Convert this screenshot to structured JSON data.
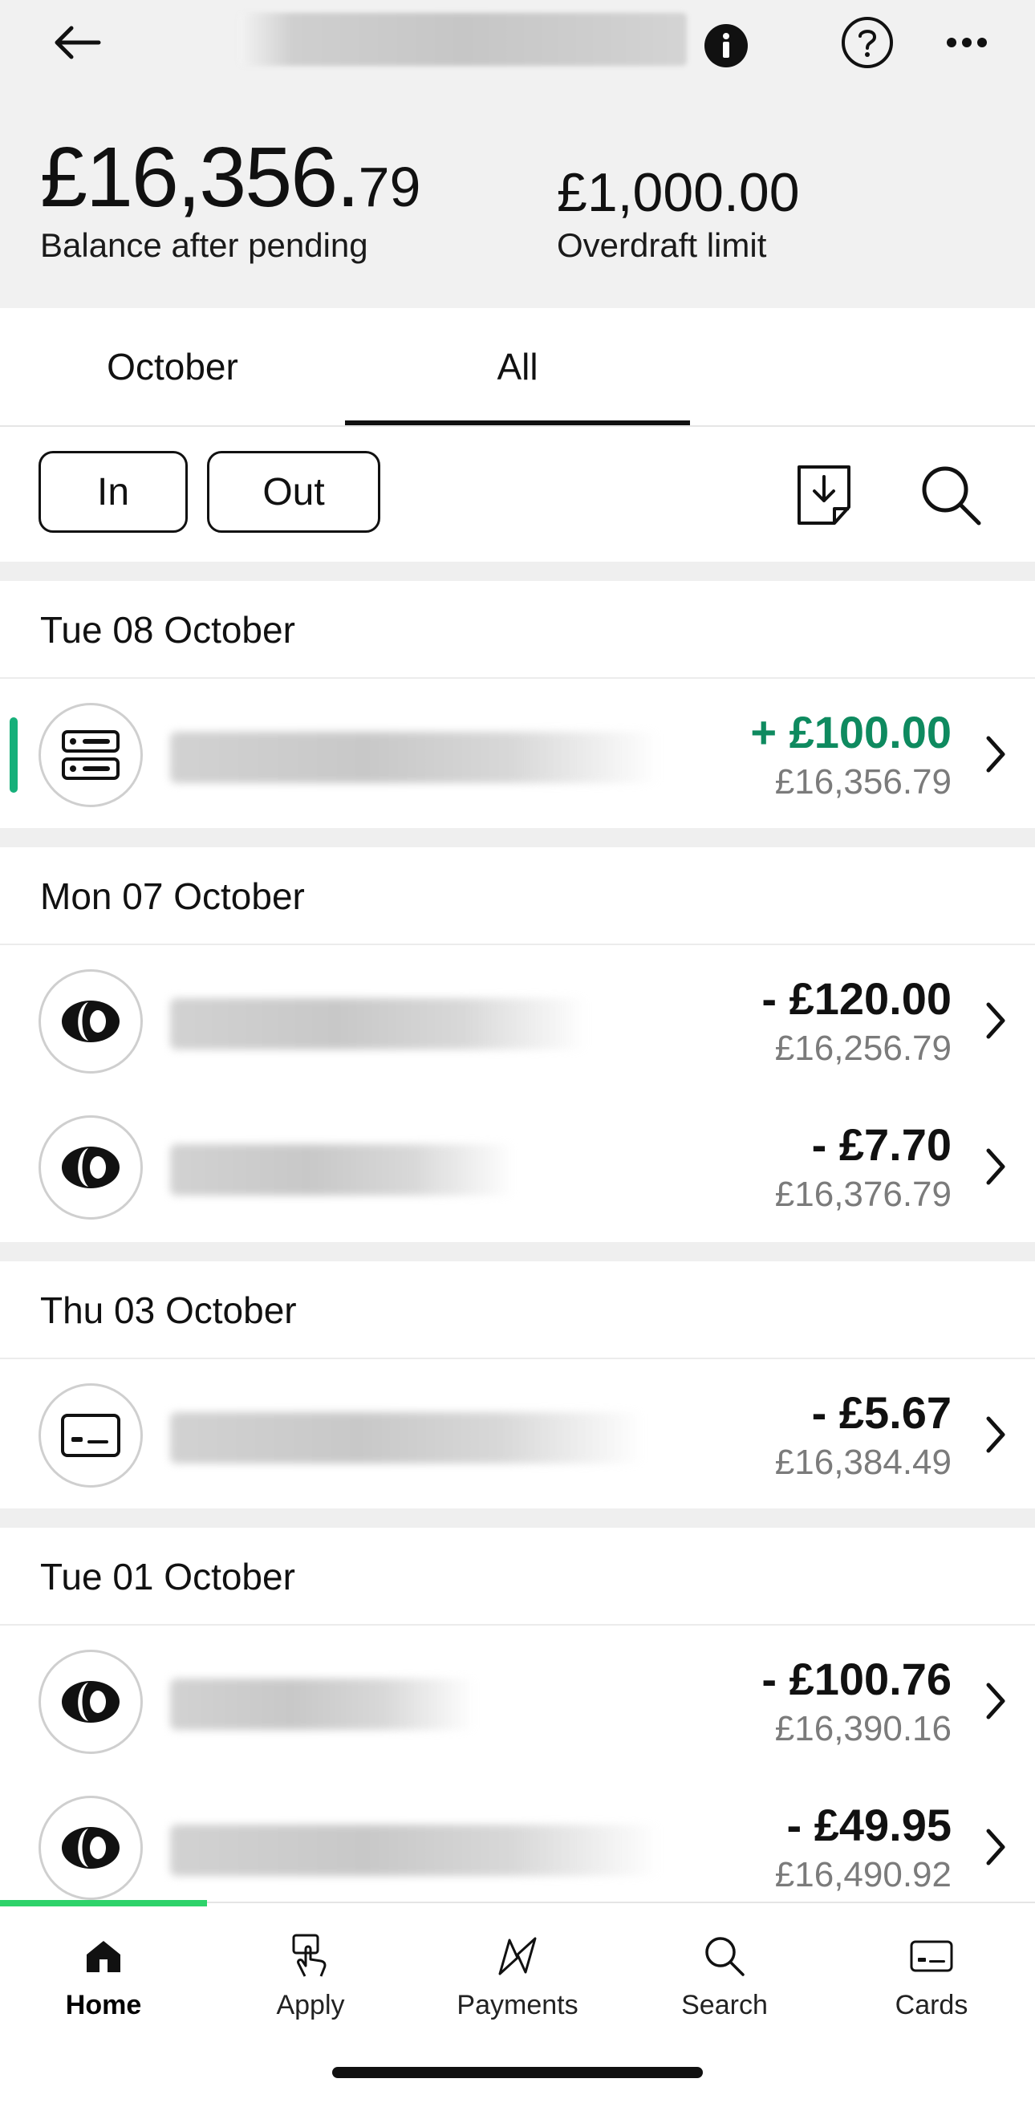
{
  "header": {
    "balance_main": "£16,356.",
    "balance_cents": "79",
    "balance_label": "Balance after pending",
    "overdraft_amount": "£1,000.00",
    "overdraft_label": "Overdraft limit",
    "icons": [
      "back-arrow-icon",
      "info-icon",
      "help-icon",
      "more-icon"
    ]
  },
  "tabs": [
    {
      "label": "October",
      "active": false
    },
    {
      "label": "All",
      "active": true
    }
  ],
  "filters": {
    "in_label": "In",
    "out_label": "Out",
    "icons": [
      "download-statement-icon",
      "search-icon"
    ]
  },
  "groups": [
    {
      "date": "Tue 08 October",
      "transactions": [
        {
          "icon": "bank-transfer-icon",
          "amount": "+ £100.00",
          "balance": "£16,356.79",
          "direction": "in"
        }
      ]
    },
    {
      "date": "Mon 07 October",
      "transactions": [
        {
          "icon": "card-network-icon",
          "amount": "- £120.00",
          "balance": "£16,256.79",
          "direction": "out"
        },
        {
          "icon": "card-network-icon",
          "amount": "- £7.70",
          "balance": "£16,376.79",
          "direction": "out"
        }
      ]
    },
    {
      "date": "Thu 03 October",
      "transactions": [
        {
          "icon": "card-icon",
          "amount": "- £5.67",
          "balance": "£16,384.49",
          "direction": "out"
        }
      ]
    },
    {
      "date": "Tue 01 October",
      "transactions": [
        {
          "icon": "card-network-icon",
          "amount": "- £100.76",
          "balance": "£16,390.16",
          "direction": "out"
        },
        {
          "icon": "card-network-icon",
          "amount": "- £49.95",
          "balance": "£16,490.92",
          "direction": "out"
        }
      ]
    }
  ],
  "bottom_nav": [
    {
      "label": "Home",
      "icon": "home-icon",
      "active": true
    },
    {
      "label": "Apply",
      "icon": "apply-icon",
      "active": false
    },
    {
      "label": "Payments",
      "icon": "payments-icon",
      "active": false
    },
    {
      "label": "Search",
      "icon": "search-icon",
      "active": false
    },
    {
      "label": "Cards",
      "icon": "cards-icon",
      "active": false
    }
  ],
  "colors": {
    "positive_amount": "#0e8a5f",
    "accent_bar": "#16b07a",
    "nav_progress": "#2ed36a"
  }
}
